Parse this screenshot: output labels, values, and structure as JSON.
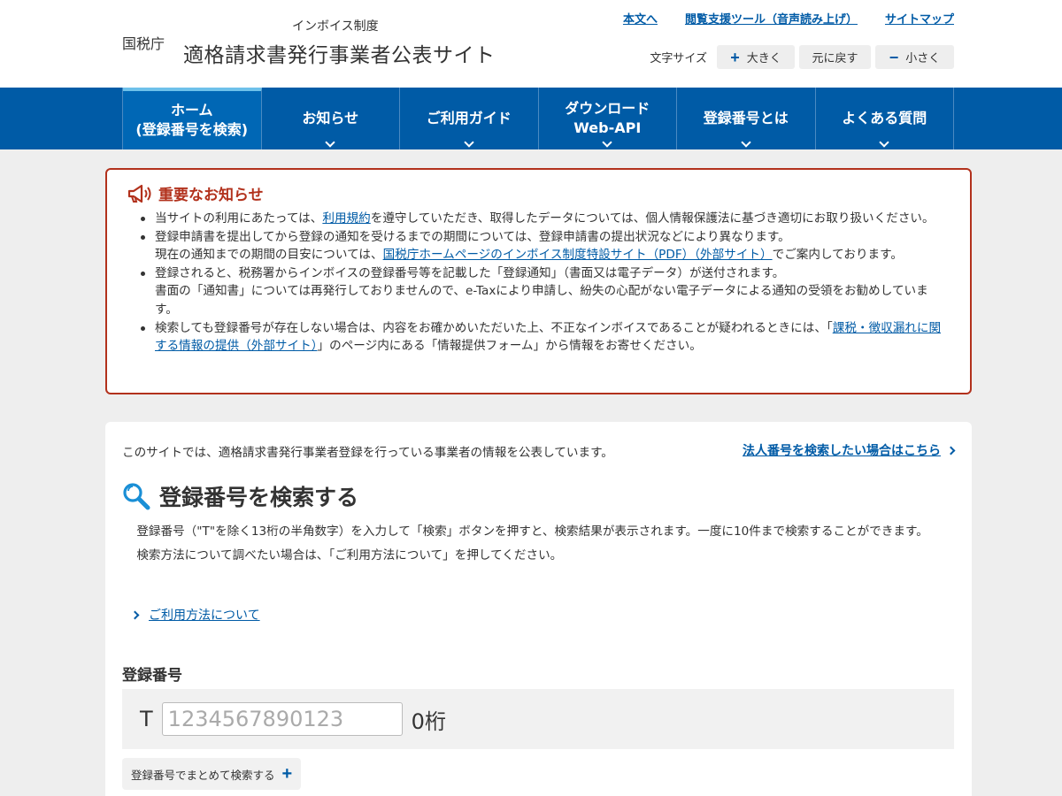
{
  "header": {
    "agency": "国税庁",
    "subtitle": "インボイス制度",
    "title": "適格請求書発行事業者公表サイト",
    "links": [
      "本文へ",
      "閲覧支援ツール（音声読み上げ）",
      "サイトマップ"
    ],
    "font_size_label": "文字サイズ",
    "font_buttons": {
      "larger": "大きく",
      "reset": "元に戻す",
      "smaller": "小さく"
    }
  },
  "nav": {
    "items": [
      {
        "line1": "ホーム",
        "line2": "(登録番号を検索)"
      },
      {
        "line1": "お知らせ",
        "line2": ""
      },
      {
        "line1": "ご利用ガイド",
        "line2": ""
      },
      {
        "line1": "ダウンロード",
        "line2": "Web-API"
      },
      {
        "line1": "登録番号とは",
        "line2": ""
      },
      {
        "line1": "よくある質問",
        "line2": ""
      }
    ]
  },
  "notice": {
    "title": "重要なお知らせ",
    "item1_pre": "当サイトの利用にあたっては、",
    "item1_link": "利用規約",
    "item1_post": "を遵守していただき、取得したデータについては、個人情報保護法に基づき適切にお取り扱いください。",
    "item2_line1": "登録申請書を提出してから登録の通知を受けるまでの期間については、登録申請書の提出状況などにより異なります。",
    "item2_pre": "現在の通知までの期間の目安については、",
    "item2_link": "国税庁ホームページのインボイス制度特設サイト（PDF）（外部サイト）",
    "item2_post": "でご案内しております。",
    "item3_line1": "登録されると、税務署からインボイスの登録番号等を記載した「登録通知」（書面又は電子データ）が送付されます。",
    "item3_line2": "書面の「通知書」については再発行しておりませんので、e-Taxにより申請し、紛失の心配がない電子データによる通知の受領をお勧めしています。",
    "item4_pre": "検索しても登録番号が存在しない場合は、内容をお確かめいただいた上、不正なインボイスであることが疑われるときには、「",
    "item4_link": "課税・徴収漏れに関する情報の提供（外部サイト）",
    "item4_post": "」のページ内にある「情報提供フォーム」から情報をお寄せください。"
  },
  "main": {
    "intro": "このサイトでは、適格請求書発行事業者登録を行っている事業者の情報を公表しています。",
    "corp_link": "法人番号を検索したい場合はこちら",
    "heading": "登録番号を検索する",
    "desc1": "登録番号（\"T\"を除く13桁の半角数字）を入力して「検索」ボタンを押すと、検索結果が表示されます。一度に10件まで検索することができます。",
    "desc2": "検索方法について調べたい場合は、「ご利用方法について」を押してください。",
    "guide_link": "ご利用方法について",
    "field_label": "登録番号",
    "prefix": "T",
    "input_placeholder": "1234567890123",
    "input_value": "",
    "digit_count": "0桁",
    "bulk_button": "登録番号でまとめて検索する"
  },
  "colors": {
    "primary": "#005ba6",
    "alert": "#b2311c",
    "background": "#eeeeee"
  }
}
